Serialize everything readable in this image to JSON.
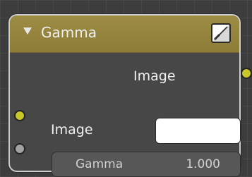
{
  "node": {
    "title": "Gamma",
    "header_color": "#9d8c42",
    "collapse_icon": "triangle-down-icon",
    "preview_icon": "preview-toggle-icon"
  },
  "outputs": [
    {
      "label": "Image",
      "socket_color": "#c7c729"
    }
  ],
  "inputs": [
    {
      "label": "Image",
      "socket_color": "#c7c729",
      "value_color": "#ffffff"
    },
    {
      "label": "Gamma",
      "value": "1.000",
      "socket_color": "#a1a1a1"
    }
  ]
}
